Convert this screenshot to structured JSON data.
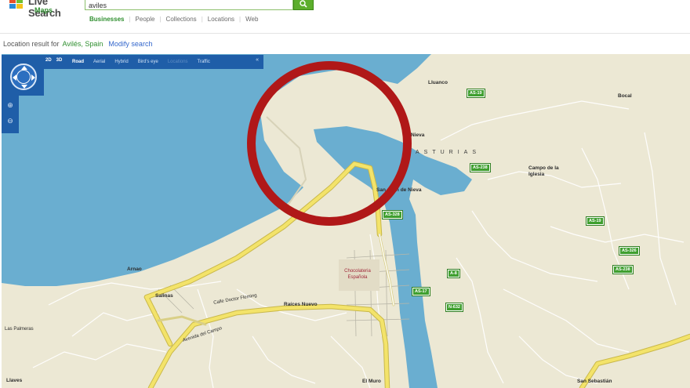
{
  "header": {
    "brand": "Live Search",
    "product": "Maps",
    "search_value": "aviles",
    "scopes": [
      {
        "label": "Businesses",
        "active": true
      },
      {
        "label": "People",
        "active": false
      },
      {
        "label": "Collections",
        "active": false
      },
      {
        "label": "Locations",
        "active": false
      },
      {
        "label": "Web",
        "active": false
      }
    ]
  },
  "result": {
    "prefix": "Location result for",
    "place": "Avilés, Spain",
    "link": "Modify search"
  },
  "toolbar": {
    "zoom_levels": [
      "2D",
      "3D"
    ],
    "items": [
      {
        "label": "Road",
        "state": "active"
      },
      {
        "label": "Aerial",
        "state": "normal"
      },
      {
        "label": "Hybrid",
        "state": "normal"
      },
      {
        "label": "Bird's eye",
        "state": "normal"
      },
      {
        "label": "Locations",
        "state": "dim"
      },
      {
        "label": "Traffic",
        "state": "normal"
      }
    ],
    "close_glyph": "«"
  },
  "map": {
    "labels": {
      "luanco": "Lluanco",
      "nieva": "Nieva",
      "region": "ASTURIAS",
      "sanjuan": "San Juan de Nieva",
      "campo": "Campo de la Iglesia",
      "bocal": "Bocal",
      "poi": "Chocolateria Española",
      "salinas": "Salinas",
      "raices": "Raíces Nuevo",
      "arnao": "Arnao",
      "laspalmeras": "Las Palmeras",
      "sansebastian": "San Sebastián",
      "elmuro": "El Muro",
      "llaves": "Llaves",
      "road_a": "Avenida del Campo",
      "road_b": "Calle Doctor Fleming"
    },
    "shields": [
      "AS-19",
      "AS-238",
      "AS-328",
      "AS-19",
      "AS-326",
      "A-8",
      "AS-17",
      "AS-238",
      "N-632"
    ]
  },
  "colors": {
    "water": "#6aaed0",
    "land": "#ece8d4",
    "road_major": "#f3e36a",
    "toolbar": "#1f5ea8",
    "highlight": "#b01818"
  }
}
